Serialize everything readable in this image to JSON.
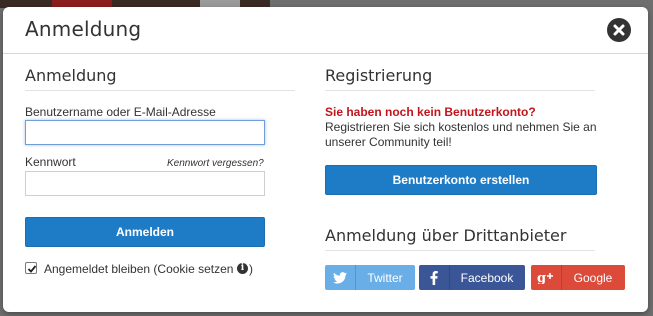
{
  "modal": {
    "title": "Anmeldung"
  },
  "login": {
    "heading": "Anmeldung",
    "username_label": "Benutzername oder E-Mail-Adresse",
    "username_value": "",
    "password_label": "Kennwort",
    "password_value": "",
    "forgot_link": "Kennwort vergessen?",
    "submit_label": "Anmelden",
    "remember_label": "Angemeldet bleiben (Cookie setzen",
    "remember_close": ")",
    "remember_checked": true
  },
  "register": {
    "heading": "Registrierung",
    "warning": "Sie haben noch kein Benutzerkonto?",
    "description": "Registrieren Sie sich kostenlos und nehmen Sie an unserer Community teil!",
    "create_label": "Benutzerkonto erstellen"
  },
  "third_party": {
    "heading": "Anmeldung über Drittanbieter",
    "buttons": [
      {
        "label": "Twitter",
        "icon": "twitter-icon",
        "color": "#6aaee8"
      },
      {
        "label": "Facebook",
        "icon": "facebook-icon",
        "color": "#3b5697"
      },
      {
        "label": "Google",
        "icon": "google-plus-icon",
        "color": "#dc4a39"
      }
    ]
  },
  "colors": {
    "primary": "#1e7cc6",
    "warning": "#c0161c",
    "text": "#333333"
  }
}
